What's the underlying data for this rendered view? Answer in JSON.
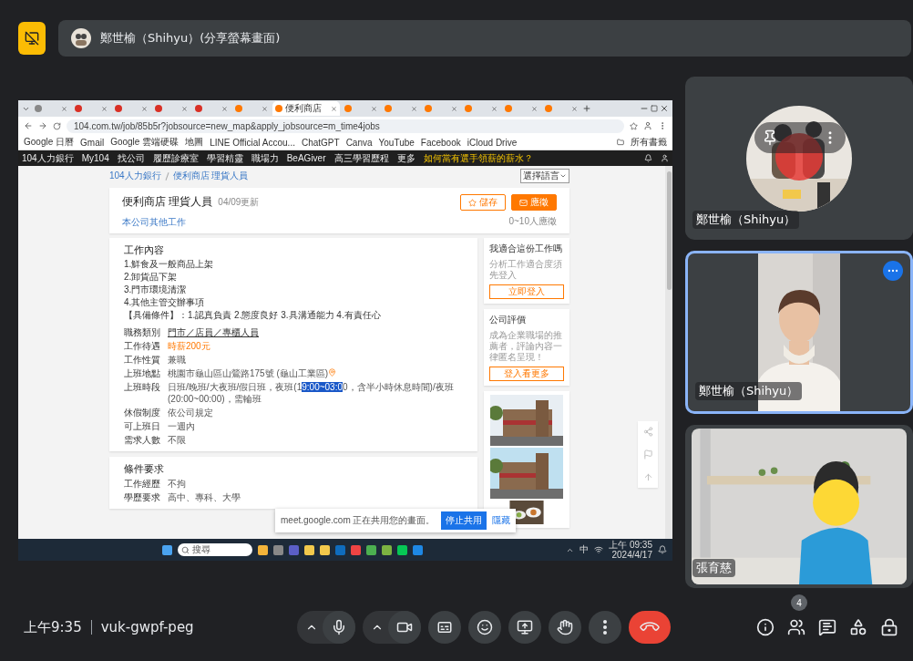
{
  "top_bar": {
    "presenter_label": "鄭世榆（Shihyu）(分享螢幕畫面)"
  },
  "shared_screen": {
    "browser": {
      "tabs": [
        {
          "selected": false
        },
        {
          "selected": false
        },
        {
          "selected": false
        },
        {
          "selected": false
        },
        {
          "selected": false
        },
        {
          "selected": false
        },
        {
          "title": "便利商店",
          "selected": true
        },
        {
          "selected": false
        },
        {
          "selected": false
        },
        {
          "selected": false
        },
        {
          "selected": false
        },
        {
          "selected": false
        },
        {
          "selected": false
        }
      ],
      "url": "104.com.tw/job/85b5r?jobsource=new_map&apply_jobsource=m_time4jobs",
      "bookmarks": [
        "Google 日曆",
        "Gmail",
        "Google 雲端硬碟",
        "地圖",
        "LINE Official Accou...",
        "ChatGPT",
        "Canva",
        "YouTube",
        "Facebook",
        "iCloud Drive"
      ],
      "all_bookmarks": "所有書籤",
      "site_nav": [
        "104人力銀行",
        "My104",
        "找公司",
        "履歷診療室",
        "學習精靈",
        "職場力",
        "BeAGiver",
        "高三學習歷程",
        "更多"
      ],
      "site_promo": "如何當有選手領薪的薪水？"
    },
    "page": {
      "breadcrumb": [
        "104人力銀行",
        "便利商店 理貨人員"
      ],
      "language_select": "選擇語言",
      "job": {
        "title": "便利商店 理貨人員",
        "updated": "04/09更新",
        "other_jobs": "本公司其他工作",
        "save": "儲存",
        "apply": "應徵",
        "applicants": "0~10人應徵"
      },
      "description_title": "工作內容",
      "description": [
        "1.鮮食及一般商品上架",
        "2.卸貨品下架",
        "3.門市環境清潔",
        "4.其他主管交辦事項",
        "【具備條件】：1.認真負責 2.態度良好 3.具溝通能力 4.有責任心"
      ],
      "fields": [
        {
          "label": "職務類別",
          "kind": "link",
          "value_parts": [
            {
              "text": "門市／店員／專櫃人員",
              "highlighted": false
            }
          ]
        },
        {
          "label": "工作待遇",
          "kind": "salary",
          "value_parts": [
            {
              "text": "時薪200元",
              "highlighted": false
            }
          ]
        },
        {
          "label": "工作性質",
          "kind": "text",
          "value_parts": [
            {
              "text": "兼職",
              "highlighted": false
            }
          ]
        },
        {
          "label": "上班地點",
          "kind": "location",
          "value_parts": [
            {
              "text": "桃園市龜山區山鶯路175號 (龜山工業區)",
              "highlighted": false
            }
          ]
        },
        {
          "label": "上班時段",
          "kind": "text",
          "value_parts": [
            {
              "text": "日班/晚班/大夜班/假日班，夜班(1",
              "highlighted": false
            },
            {
              "text": "9:00~03:0",
              "highlighted": true
            },
            {
              "text": "0，含半小時休息時間)/夜班(20:00~00:00)，需輪班",
              "highlighted": false
            }
          ]
        },
        {
          "label": "休假制度",
          "kind": "text",
          "value_parts": [
            {
              "text": "依公司規定",
              "highlighted": false
            }
          ]
        },
        {
          "label": "可上班日",
          "kind": "text",
          "value_parts": [
            {
              "text": "一週內",
              "highlighted": false
            }
          ]
        },
        {
          "label": "需求人數",
          "kind": "text",
          "value_parts": [
            {
              "text": "不限",
              "highlighted": false
            }
          ]
        }
      ],
      "requirements_title": "條件要求",
      "requirements": [
        {
          "label": "工作經歷",
          "value": "不拘"
        },
        {
          "label": "學歷要求",
          "value": "高中、專科、大學"
        }
      ],
      "fit_card": {
        "title": "我適合這份工作嗎",
        "hint": "分析工作適合度須先登入",
        "button": "立即登入"
      },
      "review_card": {
        "title": "公司評價",
        "hint": "成為企業職場的推薦者，評論內容一律匿名呈現！",
        "button": "登入看更多"
      }
    },
    "share_notice": {
      "message": "meet.google.com 正在共用您的畫面。",
      "stop": "停止共用",
      "hide": "隱藏"
    },
    "taskbar": {
      "search_placeholder": "搜尋",
      "ime": "中",
      "time": "上午 09:35",
      "date": "2024/4/17"
    }
  },
  "participants": [
    {
      "name": "鄭世榆（Shihyu）",
      "kind": "avatar",
      "hovered": true,
      "highlighted": false
    },
    {
      "name": "鄭世榆（Shihyu）",
      "kind": "video",
      "hovered": false,
      "highlighted": true
    },
    {
      "name": "張育慈",
      "kind": "video2",
      "hovered": false,
      "highlighted": false
    }
  ],
  "bottom_bar": {
    "time": "上午9:35",
    "meeting_code": "vuk-gwpf-peg",
    "participant_count": "4"
  }
}
